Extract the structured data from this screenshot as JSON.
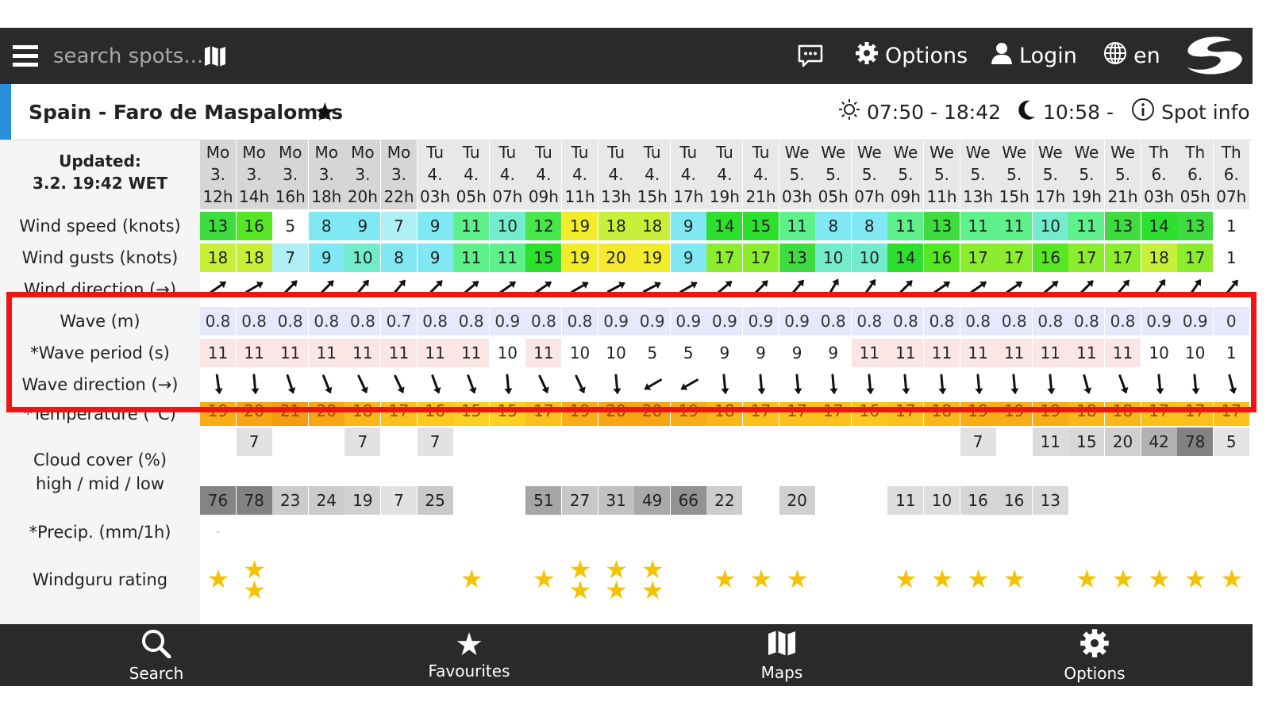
{
  "header": {
    "search_placeholder": "search spots...",
    "options_label": "Options",
    "login_label": "Login",
    "language_label": "en"
  },
  "spot": {
    "name": "Spain - Faro de Maspalomas",
    "sun_times": "07:50 - 18:42",
    "moon_times": "10:58 -",
    "spot_info_label": "Spot info"
  },
  "updated": {
    "label": "Updated:",
    "value": "3.2. 19:42 WET"
  },
  "row_labels": {
    "wind_speed": "Wind speed (knots)",
    "wind_gusts": "Wind gusts (knots)",
    "wind_direction": "Wind direction (→)",
    "wave": "Wave (m)",
    "wave_period": "*Wave period (s)",
    "wave_direction": "Wave direction (→)",
    "temperature": "*Temperature (°C)",
    "cloud_cover": "Cloud cover (%)",
    "cloud_cover_sub": "high / mid / low",
    "precip": "*Precip. (mm/1h)",
    "rating": "Windguru rating"
  },
  "forecast": {
    "columns": [
      {
        "day": "Mo",
        "date": "3.",
        "hour": "12h",
        "wind": "13",
        "gust": "18",
        "wdir": 55,
        "wave": "0.8",
        "period": "11",
        "vdir": 172,
        "temp": "19",
        "cloud_high": "",
        "cloud_mid": "",
        "cloud_low": "76",
        "precip": "-",
        "rating": 1
      },
      {
        "day": "Mo",
        "date": "3.",
        "hour": "14h",
        "wind": "16",
        "gust": "18",
        "wdir": 60,
        "wave": "0.8",
        "period": "11",
        "vdir": 175,
        "temp": "20",
        "cloud_high": "7",
        "cloud_mid": "",
        "cloud_low": "78",
        "precip": "",
        "rating": 2
      },
      {
        "day": "Mo",
        "date": "3.",
        "hour": "16h",
        "wind": "5",
        "gust": "7",
        "wdir": 45,
        "wave": "0.8",
        "period": "11",
        "vdir": 162,
        "temp": "21",
        "cloud_high": "",
        "cloud_mid": "",
        "cloud_low": "23",
        "precip": "",
        "rating": 0
      },
      {
        "day": "Mo",
        "date": "3.",
        "hour": "18h",
        "wind": "8",
        "gust": "9",
        "wdir": 45,
        "wave": "0.8",
        "period": "11",
        "vdir": 158,
        "temp": "20",
        "cloud_high": "",
        "cloud_mid": "",
        "cloud_low": "24",
        "precip": "",
        "rating": 0
      },
      {
        "day": "Mo",
        "date": "3.",
        "hour": "20h",
        "wind": "9",
        "gust": "10",
        "wdir": 40,
        "wave": "0.8",
        "period": "11",
        "vdir": 155,
        "temp": "18",
        "cloud_high": "7",
        "cloud_mid": "",
        "cloud_low": "19",
        "precip": "",
        "rating": 0
      },
      {
        "day": "Mo",
        "date": "3.",
        "hour": "22h",
        "wind": "7",
        "gust": "8",
        "wdir": 40,
        "wave": "0.7",
        "period": "11",
        "vdir": 155,
        "temp": "17",
        "cloud_high": "",
        "cloud_mid": "",
        "cloud_low": "7",
        "precip": "",
        "rating": 0
      },
      {
        "day": "Tu",
        "date": "4.",
        "hour": "03h",
        "wind": "9",
        "gust": "9",
        "wdir": 45,
        "wave": "0.8",
        "period": "11",
        "vdir": 160,
        "temp": "16",
        "cloud_high": "7",
        "cloud_mid": "",
        "cloud_low": "25",
        "precip": "",
        "rating": 0
      },
      {
        "day": "Tu",
        "date": "4.",
        "hour": "05h",
        "wind": "11",
        "gust": "11",
        "wdir": 50,
        "wave": "0.8",
        "period": "11",
        "vdir": 160,
        "temp": "15",
        "cloud_high": "",
        "cloud_mid": "",
        "cloud_low": "",
        "precip": "",
        "rating": 1
      },
      {
        "day": "Tu",
        "date": "4.",
        "hour": "07h",
        "wind": "10",
        "gust": "11",
        "wdir": 55,
        "wave": "0.9",
        "period": "10",
        "vdir": 175,
        "temp": "15",
        "cloud_high": "",
        "cloud_mid": "",
        "cloud_low": "",
        "precip": "",
        "rating": 0
      },
      {
        "day": "Tu",
        "date": "4.",
        "hour": "09h",
        "wind": "12",
        "gust": "15",
        "wdir": 55,
        "wave": "0.8",
        "period": "11",
        "vdir": 155,
        "temp": "17",
        "cloud_high": "",
        "cloud_mid": "",
        "cloud_low": "51",
        "precip": "",
        "rating": 1
      },
      {
        "day": "Tu",
        "date": "4.",
        "hour": "11h",
        "wind": "19",
        "gust": "19",
        "wdir": 60,
        "wave": "0.8",
        "period": "10",
        "vdir": 155,
        "temp": "19",
        "cloud_high": "",
        "cloud_mid": "",
        "cloud_low": "27",
        "precip": "",
        "rating": 2
      },
      {
        "day": "Tu",
        "date": "4.",
        "hour": "13h",
        "wind": "18",
        "gust": "20",
        "wdir": 62,
        "wave": "0.9",
        "period": "10",
        "vdir": 175,
        "temp": "20",
        "cloud_high": "",
        "cloud_mid": "",
        "cloud_low": "31",
        "precip": "",
        "rating": 2
      },
      {
        "day": "Tu",
        "date": "4.",
        "hour": "15h",
        "wind": "18",
        "gust": "19",
        "wdir": 62,
        "wave": "0.9",
        "period": "5",
        "vdir": 240,
        "temp": "20",
        "cloud_high": "",
        "cloud_mid": "",
        "cloud_low": "49",
        "precip": "",
        "rating": 2
      },
      {
        "day": "Tu",
        "date": "4.",
        "hour": "17h",
        "wind": "9",
        "gust": "9",
        "wdir": 60,
        "wave": "0.9",
        "period": "5",
        "vdir": 240,
        "temp": "19",
        "cloud_high": "",
        "cloud_mid": "",
        "cloud_low": "66",
        "precip": "",
        "rating": 0
      },
      {
        "day": "Tu",
        "date": "4.",
        "hour": "19h",
        "wind": "14",
        "gust": "17",
        "wdir": 50,
        "wave": "0.9",
        "period": "9",
        "vdir": 175,
        "temp": "18",
        "cloud_high": "",
        "cloud_mid": "",
        "cloud_low": "22",
        "precip": "",
        "rating": 1
      },
      {
        "day": "Tu",
        "date": "4.",
        "hour": "21h",
        "wind": "15",
        "gust": "17",
        "wdir": 45,
        "wave": "0.9",
        "period": "9",
        "vdir": 175,
        "temp": "17",
        "cloud_high": "",
        "cloud_mid": "",
        "cloud_low": "",
        "precip": "",
        "rating": 1
      },
      {
        "day": "We",
        "date": "5.",
        "hour": "03h",
        "wind": "11",
        "gust": "13",
        "wdir": 40,
        "wave": "0.9",
        "period": "9",
        "vdir": 175,
        "temp": "17",
        "cloud_high": "",
        "cloud_mid": "",
        "cloud_low": "20",
        "precip": "",
        "rating": 1
      },
      {
        "day": "We",
        "date": "5.",
        "hour": "05h",
        "wind": "8",
        "gust": "10",
        "wdir": 30,
        "wave": "0.8",
        "period": "9",
        "vdir": 175,
        "temp": "17",
        "cloud_high": "",
        "cloud_mid": "",
        "cloud_low": "",
        "precip": "",
        "rating": 0
      },
      {
        "day": "We",
        "date": "5.",
        "hour": "07h",
        "wind": "8",
        "gust": "10",
        "wdir": 35,
        "wave": "0.8",
        "period": "11",
        "vdir": 175,
        "temp": "16",
        "cloud_high": "",
        "cloud_mid": "",
        "cloud_low": "",
        "precip": "",
        "rating": 0
      },
      {
        "day": "We",
        "date": "5.",
        "hour": "09h",
        "wind": "11",
        "gust": "14",
        "wdir": 45,
        "wave": "0.8",
        "period": "11",
        "vdir": 175,
        "temp": "17",
        "cloud_high": "",
        "cloud_mid": "",
        "cloud_low": "11",
        "precip": "",
        "rating": 1
      },
      {
        "day": "We",
        "date": "5.",
        "hour": "11h",
        "wind": "13",
        "gust": "16",
        "wdir": 55,
        "wave": "0.8",
        "period": "11",
        "vdir": 175,
        "temp": "18",
        "cloud_high": "",
        "cloud_mid": "",
        "cloud_low": "10",
        "precip": "",
        "rating": 1
      },
      {
        "day": "We",
        "date": "5.",
        "hour": "13h",
        "wind": "11",
        "gust": "17",
        "wdir": 55,
        "wave": "0.8",
        "period": "11",
        "vdir": 175,
        "temp": "19",
        "cloud_high": "7",
        "cloud_mid": "",
        "cloud_low": "16",
        "precip": "",
        "rating": 1
      },
      {
        "day": "We",
        "date": "5.",
        "hour": "15h",
        "wind": "11",
        "gust": "17",
        "wdir": 55,
        "wave": "0.8",
        "period": "11",
        "vdir": 175,
        "temp": "19",
        "cloud_high": "",
        "cloud_mid": "",
        "cloud_low": "16",
        "precip": "",
        "rating": 1
      },
      {
        "day": "We",
        "date": "5.",
        "hour": "17h",
        "wind": "10",
        "gust": "16",
        "wdir": 50,
        "wave": "0.8",
        "period": "11",
        "vdir": 175,
        "temp": "19",
        "cloud_high": "11",
        "cloud_mid": "",
        "cloud_low": "13",
        "precip": "",
        "rating": 0
      },
      {
        "day": "We",
        "date": "5.",
        "hour": "19h",
        "wind": "11",
        "gust": "17",
        "wdir": 45,
        "wave": "0.8",
        "period": "11",
        "vdir": 165,
        "temp": "18",
        "cloud_high": "15",
        "cloud_mid": "",
        "cloud_low": "",
        "precip": "",
        "rating": 1
      },
      {
        "day": "We",
        "date": "5.",
        "hour": "21h",
        "wind": "13",
        "gust": "17",
        "wdir": 40,
        "wave": "0.8",
        "period": "11",
        "vdir": 160,
        "temp": "18",
        "cloud_high": "20",
        "cloud_mid": "",
        "cloud_low": "",
        "precip": "",
        "rating": 1
      },
      {
        "day": "Th",
        "date": "6.",
        "hour": "03h",
        "wind": "14",
        "gust": "18",
        "wdir": 35,
        "wave": "0.9",
        "period": "10",
        "vdir": 175,
        "temp": "17",
        "cloud_high": "42",
        "cloud_mid": "",
        "cloud_low": "",
        "precip": "",
        "rating": 1
      },
      {
        "day": "Th",
        "date": "6.",
        "hour": "05h",
        "wind": "13",
        "gust": "17",
        "wdir": 35,
        "wave": "0.9",
        "period": "10",
        "vdir": 175,
        "temp": "17",
        "cloud_high": "78",
        "cloud_mid": "",
        "cloud_low": "",
        "precip": "",
        "rating": 1
      },
      {
        "day": "Th",
        "date": "6.",
        "hour": "07h",
        "wind": "1",
        "gust": "1",
        "wdir": 40,
        "wave": "0",
        "period": "1",
        "vdir": 165,
        "temp": "17",
        "cloud_high": "5",
        "cloud_mid": "",
        "cloud_low": "",
        "precip": "",
        "rating": 1
      }
    ]
  },
  "bottom_nav": {
    "search": "Search",
    "favourites": "Favourites",
    "maps": "Maps",
    "options": "Options"
  },
  "colors": {
    "topbar": "#2a2a2a",
    "accent": "#2a8ddb",
    "highlight_box": "#ee1515",
    "star": "#f3c200"
  }
}
